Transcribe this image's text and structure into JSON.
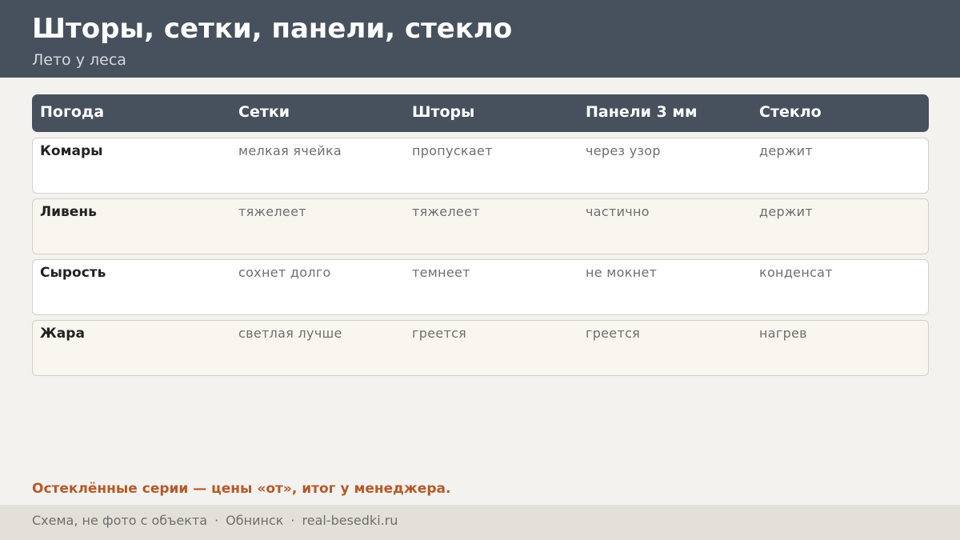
{
  "header": {
    "title": "Шторы, сетки, панели, стекло",
    "subtitle": "Лето у леса"
  },
  "table": {
    "columns": [
      "Погода",
      "Сетки",
      "Шторы",
      "Панели 3 мм",
      "Стекло"
    ],
    "rows": [
      [
        "Комары",
        "мелкая ячейка",
        "пропускает",
        "через узор",
        "держит"
      ],
      [
        "Ливень",
        "тяжелеет",
        "тяжелеет",
        "частично",
        "держит"
      ],
      [
        "Сырость",
        "сохнет долго",
        "темнеет",
        "не мокнет",
        "конденсат"
      ],
      [
        "Жара",
        "светлая лучше",
        "греется",
        "греется",
        "нагрев"
      ]
    ]
  },
  "note": "Остеклённые серии — цены «от», итог у менеджера.",
  "footer": {
    "items": [
      "Схема, не фото с объекта",
      "Обнинск",
      "real-besedki.ru"
    ],
    "separator": "·"
  },
  "colors": {
    "header_bg": "#47515e",
    "page_bg": "#f4f2ee",
    "accent": "#b45a2b",
    "footer_bg": "#e3e0da"
  }
}
